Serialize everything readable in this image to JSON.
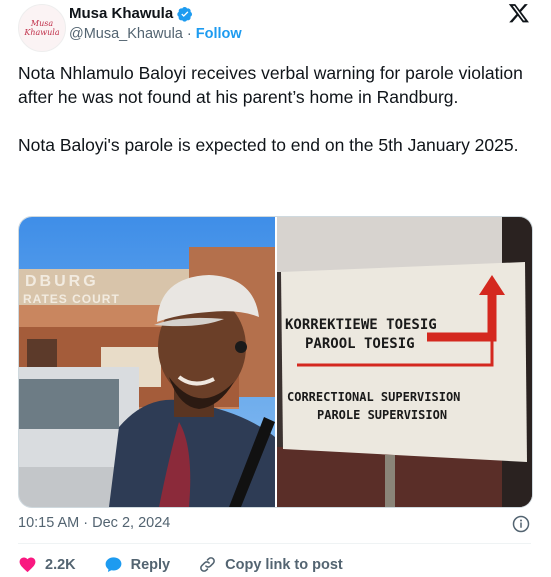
{
  "author": {
    "name": "Musa Khawula",
    "handle": "@Musa_Khawula",
    "separator": "·",
    "follow_label": "Follow",
    "avatar_text": "Musa Khawula"
  },
  "tweet": {
    "paragraph1": "Nota Nhlamulo Baloyi receives verbal warning for parole violation after he was not found at his parent’s home in Randburg.",
    "paragraph2": "Nota Baloyi's parole is expected to end on the 5th January 2025."
  },
  "media": {
    "photo1_sign_lines": [
      "DBURG",
      "RATES COURT"
    ],
    "photo2_sign_lines": [
      "KORREKTIEWE TOESIG",
      "PAROOL TOESIG",
      "CORRECTIONAL SUPERVISION",
      "PAROLE SUPERVISION"
    ]
  },
  "timestamp": "10:15 AM · Dec 2, 2024",
  "actions": {
    "likes": "2.2K",
    "reply_label": "Reply",
    "copy_label": "Copy link to post"
  },
  "colors": {
    "accent": "#1d9bf0",
    "like": "#f91880",
    "secondary_text": "#536471"
  },
  "icons": [
    "verified-badge-icon",
    "x-logo-icon",
    "info-icon",
    "heart-icon",
    "reply-icon",
    "link-icon"
  ]
}
